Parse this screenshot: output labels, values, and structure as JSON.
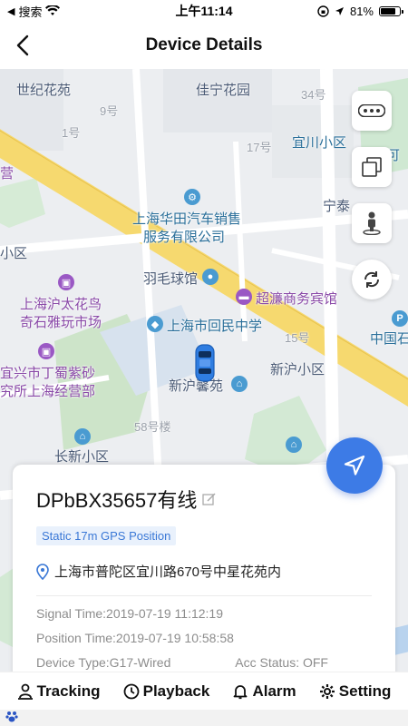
{
  "status_bar": {
    "carrier": "搜索",
    "time": "上午11:14",
    "battery": "81%",
    "battery_level": 0.81
  },
  "nav": {
    "title": "Device Details",
    "back_icon": "chevron-left-icon"
  },
  "map": {
    "labels": {
      "shijihuayuan": "世纪花苑",
      "jiayihuayuan": "佳宁花园",
      "no9": "9号",
      "no1": "1号",
      "no34": "34号",
      "no17": "17号",
      "no15": "15号",
      "no58": "58号楼",
      "yichuan": "宜川小区",
      "ningtai": "宁泰",
      "huatian": "上海华田汽车销售",
      "huatian2": "服务有限公司",
      "badminton": "羽毛球馆",
      "chaolian": "超濂商务宾馆",
      "hutai": "上海沪太花鸟",
      "hutai2": "奇石雅玩市场",
      "huimin": "上海市回民中学",
      "yixing": "宜兴市丁蜀紫砂",
      "yixing2": "究所上海经营部",
      "xinhu": "新沪馨苑",
      "xinhuxiaoqu": "新沪小区",
      "zhongguo": "中国石",
      "changxin": "长新小区",
      "ku": "可",
      "xiao": "小区",
      "ying": "营"
    }
  },
  "tools": {
    "more_icon": "more-dots-icon",
    "copy_icon": "copy-icon",
    "streetview_icon": "person-streetview-icon",
    "refresh_icon": "refresh-icon",
    "locate_icon": "crosshair-icon",
    "navigate_icon": "navigation-arrow-icon"
  },
  "device": {
    "name": "DPbBX35657有线",
    "gps_status": "Static 17m GPS Position",
    "address": "上海市普陀区宜川路670号中星花苑内",
    "signal_time": "Signal Time:2019-07-19 11:12:19",
    "position_time": "Position Time:2019-07-19 10:58:58",
    "device_type": "Device Type:G17-Wired",
    "acc_status": "Acc Status: OFF"
  },
  "actions": [
    {
      "label": "Tracking",
      "icon": "person-pin-icon"
    },
    {
      "label": "Playback",
      "icon": "history-clock-icon"
    },
    {
      "label": "Alarm",
      "icon": "bell-icon"
    },
    {
      "label": "Setting",
      "icon": "gear-icon"
    }
  ],
  "colors": {
    "accent": "#3d7be6",
    "badge_bg": "#e9f1fc",
    "badge_text": "#3a78d6",
    "muted": "#8d8d8d"
  }
}
